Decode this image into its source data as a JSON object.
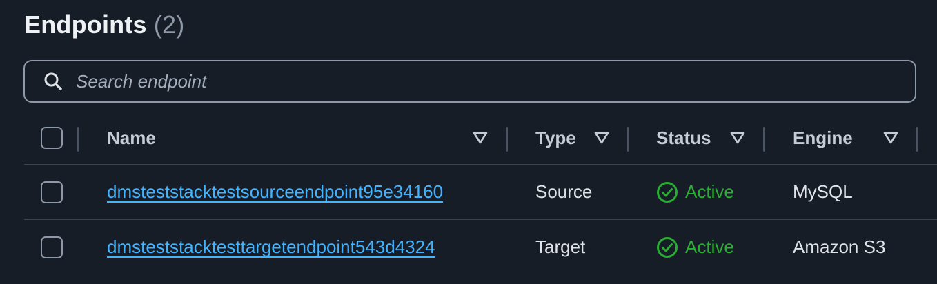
{
  "header": {
    "title": "Endpoints",
    "count": "(2)"
  },
  "search": {
    "placeholder": "Search endpoint",
    "value": ""
  },
  "table": {
    "columns": [
      {
        "label": "Name"
      },
      {
        "label": "Type"
      },
      {
        "label": "Status"
      },
      {
        "label": "Engine"
      }
    ],
    "rows": [
      {
        "name": "dmsteststacktestsourceendpoint95e34160",
        "type": "Source",
        "status": "Active",
        "engine": "MySQL"
      },
      {
        "name": "dmsteststacktesttargetendpoint543d4324",
        "type": "Target",
        "status": "Active",
        "engine": "Amazon S3"
      }
    ]
  },
  "colors": {
    "background": "#161d26",
    "link": "#42b4ff",
    "status_active": "#29ad32",
    "border": "#8d99a8"
  },
  "icons": {
    "search": "search-icon",
    "sort": "caret-down-icon",
    "status": "check-circle-icon"
  }
}
